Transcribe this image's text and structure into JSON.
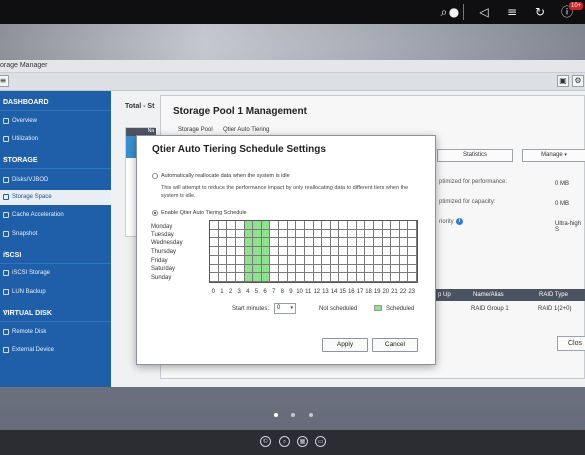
{
  "window": {
    "title": "orage Manager"
  },
  "sidebar": {
    "sections": [
      {
        "label": "DASHBOARD",
        "items": [
          "Overview",
          "Utilization"
        ]
      },
      {
        "label": "STORAGE",
        "items": [
          "Disks/VJBOD",
          "Storage Space",
          "Cache Acceleration",
          "Snapshot"
        ]
      },
      {
        "label": "iSCSI",
        "items": [
          "iSCSI Storage",
          "LUN Backup"
        ]
      },
      {
        "label": "VIRTUAL DISK",
        "items": [
          "Remote Disk",
          "External Device"
        ]
      }
    ],
    "active_item": "Storage Space"
  },
  "content": {
    "total_tab": "Total - St",
    "col_header": "Na"
  },
  "pool": {
    "title": "Storage Pool 1 Management",
    "tabs": [
      "Storage Pool",
      "Qtier Auto Tiering"
    ],
    "buttons": {
      "statistics": "Statistics",
      "manage": "Manage"
    },
    "labels": [
      "ptimized for performance:",
      "ptimized for capacity:",
      "riority"
    ],
    "values": [
      "0 MB",
      "0 MB",
      "Ultra-high S"
    ],
    "table": {
      "headers": [
        "p Up",
        "Name/Alias",
        "RAID Type"
      ],
      "row": [
        "RAID Group 1",
        "RAID 1(2+0)"
      ]
    },
    "close_label": "Clos"
  },
  "modal": {
    "title": "Qtier Auto Tiering Schedule Settings",
    "option_auto": "Automatically reallocate data when the system is idle",
    "option_auto_desc": "This will attempt to reduce the performance impact by only reallocating data to different tiers when the system is idle.",
    "option_schedule": "Enable Qtier Auto Tiering Schedule",
    "days": [
      "Monday",
      "Tuesday",
      "Wednesday",
      "Thursday",
      "Friday",
      "Saturday",
      "Sunday"
    ],
    "hours": [
      "0",
      "1",
      "2",
      "3",
      "4",
      "5",
      "6",
      "7",
      "8",
      "9",
      "10",
      "11",
      "12",
      "13",
      "14",
      "15",
      "16",
      "17",
      "18",
      "19",
      "20",
      "21",
      "22",
      "23"
    ],
    "scheduled_hours": [
      4,
      5,
      6
    ],
    "start_minutes_label": "Start minutes:",
    "start_minutes_value": "0",
    "legend_not_scheduled": "Not scheduled",
    "legend_scheduled": "Scheduled",
    "apply_label": "Apply",
    "cancel_label": "Cancel",
    "colors": {
      "scheduled": "#8fe08f",
      "not_scheduled": "#ffffff"
    }
  },
  "topbar": {
    "badge": "10+",
    "icons": [
      "search-icon",
      "user-icon",
      "volume-icon",
      "tasks-icon",
      "refresh-icon",
      "info-icon",
      "dashboard-icon"
    ]
  }
}
